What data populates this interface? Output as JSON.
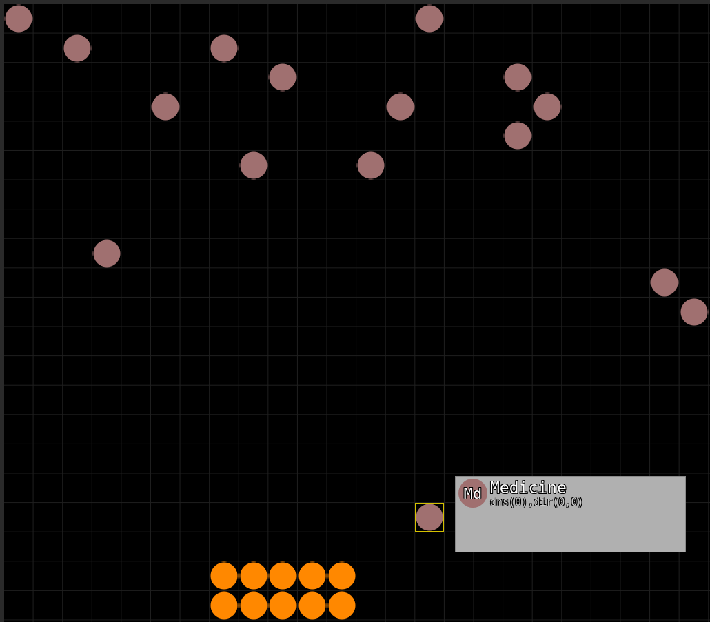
{
  "board": {
    "rows": [
      {
        "cells": [
          {
            "kind": "medicine",
            "selected": false
          },
          {
            "kind": "empty"
          },
          {
            "kind": "empty"
          },
          {
            "kind": "empty"
          },
          {
            "kind": "empty"
          },
          {
            "kind": "empty"
          },
          {
            "kind": "empty"
          },
          {
            "kind": "empty"
          },
          {
            "kind": "empty"
          },
          {
            "kind": "empty"
          },
          {
            "kind": "empty"
          },
          {
            "kind": "empty"
          },
          {
            "kind": "empty"
          },
          {
            "kind": "empty"
          },
          {
            "kind": "medicine",
            "selected": false
          }
        ]
      },
      {
        "cells": [
          {
            "kind": "empty"
          },
          {
            "kind": "empty"
          },
          {
            "kind": "medicine",
            "selected": false
          },
          {
            "kind": "empty"
          },
          {
            "kind": "empty"
          },
          {
            "kind": "empty"
          },
          {
            "kind": "empty"
          },
          {
            "kind": "medicine",
            "selected": false
          }
        ]
      },
      {
        "cells": [
          {
            "kind": "empty"
          },
          {
            "kind": "empty"
          },
          {
            "kind": "empty"
          },
          {
            "kind": "empty"
          },
          {
            "kind": "empty"
          },
          {
            "kind": "empty"
          },
          {
            "kind": "empty"
          },
          {
            "kind": "empty"
          },
          {
            "kind": "empty"
          },
          {
            "kind": "medicine",
            "selected": false
          },
          {
            "kind": "empty"
          },
          {
            "kind": "empty"
          },
          {
            "kind": "empty"
          },
          {
            "kind": "empty"
          },
          {
            "kind": "empty"
          },
          {
            "kind": "empty"
          },
          {
            "kind": "empty"
          },
          {
            "kind": "medicine",
            "selected": false
          }
        ]
      },
      {
        "cells": [
          {
            "kind": "empty"
          },
          {
            "kind": "empty"
          },
          {
            "kind": "empty"
          },
          {
            "kind": "empty"
          },
          {
            "kind": "empty"
          },
          {
            "kind": "medicine",
            "selected": false
          },
          {
            "kind": "empty"
          },
          {
            "kind": "empty"
          },
          {
            "kind": "empty"
          },
          {
            "kind": "empty"
          },
          {
            "kind": "empty"
          },
          {
            "kind": "empty"
          },
          {
            "kind": "empty"
          },
          {
            "kind": "medicine",
            "selected": false
          },
          {
            "kind": "empty"
          },
          {
            "kind": "empty"
          },
          {
            "kind": "empty"
          },
          {
            "kind": "empty"
          },
          {
            "kind": "medicine",
            "selected": false
          }
        ]
      },
      {
        "cells": [
          {
            "kind": "empty"
          },
          {
            "kind": "empty"
          },
          {
            "kind": "empty"
          },
          {
            "kind": "empty"
          },
          {
            "kind": "empty"
          },
          {
            "kind": "empty"
          },
          {
            "kind": "empty"
          },
          {
            "kind": "empty"
          },
          {
            "kind": "empty"
          },
          {
            "kind": "empty"
          },
          {
            "kind": "empty"
          },
          {
            "kind": "empty"
          },
          {
            "kind": "empty"
          },
          {
            "kind": "empty"
          },
          {
            "kind": "empty"
          },
          {
            "kind": "empty"
          },
          {
            "kind": "empty"
          },
          {
            "kind": "medicine",
            "selected": false
          }
        ]
      },
      {
        "cells": [
          {
            "kind": "empty"
          },
          {
            "kind": "empty"
          },
          {
            "kind": "empty"
          },
          {
            "kind": "empty"
          },
          {
            "kind": "empty"
          },
          {
            "kind": "empty"
          },
          {
            "kind": "empty"
          },
          {
            "kind": "empty"
          },
          {
            "kind": "medicine",
            "selected": false
          },
          {
            "kind": "empty"
          },
          {
            "kind": "empty"
          },
          {
            "kind": "empty"
          },
          {
            "kind": "medicine",
            "selected": false
          }
        ]
      },
      {},
      {},
      {
        "cells": [
          {
            "kind": "empty"
          },
          {
            "kind": "empty"
          },
          {
            "kind": "empty"
          },
          {
            "kind": "medicine",
            "selected": false
          }
        ]
      },
      {
        "cells": [
          {
            "kind": "empty"
          },
          {
            "kind": "empty"
          },
          {
            "kind": "empty"
          },
          {
            "kind": "empty"
          },
          {
            "kind": "empty"
          },
          {
            "kind": "empty"
          },
          {
            "kind": "empty"
          },
          {
            "kind": "empty"
          },
          {
            "kind": "empty"
          },
          {
            "kind": "empty"
          },
          {
            "kind": "empty"
          },
          {
            "kind": "empty"
          },
          {
            "kind": "empty"
          },
          {
            "kind": "empty"
          },
          {
            "kind": "empty"
          },
          {
            "kind": "empty"
          },
          {
            "kind": "empty"
          },
          {
            "kind": "empty"
          },
          {
            "kind": "empty"
          },
          {
            "kind": "empty"
          },
          {
            "kind": "empty"
          },
          {
            "kind": "empty"
          },
          {
            "kind": "medicine",
            "selected": false
          }
        ]
      },
      {
        "cells": [
          {
            "kind": "empty"
          },
          {
            "kind": "empty"
          },
          {
            "kind": "empty"
          },
          {
            "kind": "empty"
          },
          {
            "kind": "empty"
          },
          {
            "kind": "empty"
          },
          {
            "kind": "empty"
          },
          {
            "kind": "empty"
          },
          {
            "kind": "empty"
          },
          {
            "kind": "empty"
          },
          {
            "kind": "empty"
          },
          {
            "kind": "empty"
          },
          {
            "kind": "empty"
          },
          {
            "kind": "empty"
          },
          {
            "kind": "empty"
          },
          {
            "kind": "empty"
          },
          {
            "kind": "empty"
          },
          {
            "kind": "empty"
          },
          {
            "kind": "empty"
          },
          {
            "kind": "empty"
          },
          {
            "kind": "empty"
          },
          {
            "kind": "empty"
          },
          {
            "kind": "empty"
          },
          {
            "kind": "medicine",
            "selected": false
          }
        ]
      },
      {},
      {},
      {},
      {},
      {},
      {},
      {
        "cells": [
          {
            "kind": "empty"
          },
          {
            "kind": "empty"
          },
          {
            "kind": "empty"
          },
          {
            "kind": "empty"
          },
          {
            "kind": "empty"
          },
          {
            "kind": "empty"
          },
          {
            "kind": "empty"
          },
          {
            "kind": "empty"
          },
          {
            "kind": "empty"
          },
          {
            "kind": "empty"
          },
          {
            "kind": "empty"
          },
          {
            "kind": "empty"
          },
          {
            "kind": "empty"
          },
          {
            "kind": "empty"
          },
          {
            "kind": "medicine",
            "selected": true
          }
        ]
      },
      {},
      {
        "cells": [
          {
            "kind": "empty"
          },
          {
            "kind": "empty"
          },
          {
            "kind": "empty"
          },
          {
            "kind": "empty"
          },
          {
            "kind": "empty"
          },
          {
            "kind": "empty"
          },
          {
            "kind": "empty"
          },
          {
            "kind": "unit",
            "selected": false
          },
          {
            "kind": "unit",
            "selected": false
          },
          {
            "kind": "unit",
            "selected": false
          },
          {
            "kind": "unit",
            "selected": false
          },
          {
            "kind": "unit",
            "selected": false
          }
        ]
      },
      {
        "cells": [
          {
            "kind": "empty"
          },
          {
            "kind": "empty"
          },
          {
            "kind": "empty"
          },
          {
            "kind": "empty"
          },
          {
            "kind": "empty"
          },
          {
            "kind": "empty"
          },
          {
            "kind": "empty"
          },
          {
            "kind": "unit",
            "selected": false
          },
          {
            "kind": "unit",
            "selected": false
          },
          {
            "kind": "unit",
            "selected": false
          },
          {
            "kind": "unit",
            "selected": false
          },
          {
            "kind": "unit",
            "selected": false
          }
        ]
      }
    ]
  },
  "tooltip": {
    "symbol": "Md",
    "name": "Medicine",
    "detail": "dns(0),dir(0,0)"
  }
}
